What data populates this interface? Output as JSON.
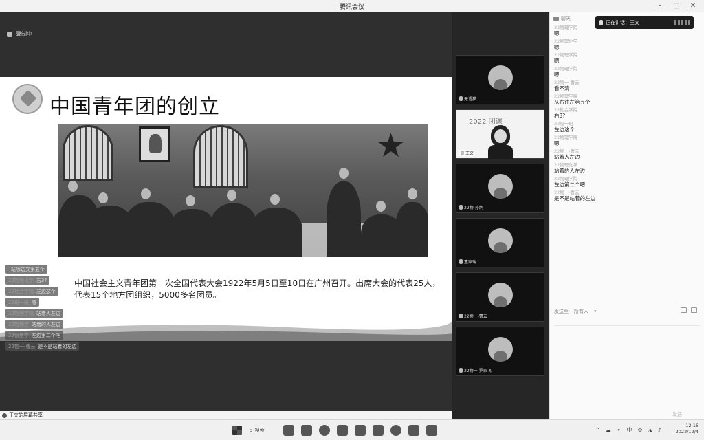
{
  "window": {
    "title": "腾讯会议"
  },
  "recording": {
    "label": "录制中"
  },
  "slide": {
    "title": "中国青年团的创立",
    "body": "中国社会主义青年团第一次全国代表大会1922年5月5日至10日在广州召开。出席大会的代表25人，代表15个地方团组织，5000多名团员。"
  },
  "overlay_chat": [
    {
      "sender": "",
      "text": "站哪边文第五个"
    },
    {
      "sender": "22物理化学",
      "text": "右3?"
    },
    {
      "sender": "22社会学院",
      "text": "左边这个"
    },
    {
      "sender": "22级一班",
      "text": "嗯"
    },
    {
      "sender": "22物理学院",
      "text": "站着人左边"
    },
    {
      "sender": "22物理学",
      "text": "站着的人左边"
    },
    {
      "sender": "22智慧学",
      "text": "左边第二个吧"
    },
    {
      "sender": "22物一-曹云",
      "text": "是不是站着的左边"
    }
  ],
  "share_note": "王文的屏幕共享",
  "speaking": {
    "label": "正在讲话：王文"
  },
  "participants": [
    {
      "name": "无语猫",
      "type": "avatar"
    },
    {
      "name": "王文",
      "type": "video",
      "bg_text": "2022 团课"
    },
    {
      "name": "22物-孙炳",
      "type": "avatar"
    },
    {
      "name": "董家瑞",
      "type": "avatar"
    },
    {
      "name": "22物一-曹云",
      "type": "avatar"
    },
    {
      "name": "22物一-罗家飞",
      "type": "avatar"
    }
  ],
  "chat_panel": {
    "header": "聊天",
    "messages": [
      {
        "sender": "22物理学院",
        "text": "嗯"
      },
      {
        "sender": "22物理化学",
        "text": "嗯"
      },
      {
        "sender": "22物理学院",
        "text": "嗯"
      },
      {
        "sender": "22物理学院",
        "text": "嗯"
      },
      {
        "sender": "22物一-曹云",
        "text": "看不清"
      },
      {
        "sender": "22物理学院",
        "text": "从右往左第五个"
      },
      {
        "sender": "22社会学院",
        "text": "右3?"
      },
      {
        "sender": "22级一班",
        "text": "左边这个"
      },
      {
        "sender": "22物理学院",
        "text": "嗯"
      },
      {
        "sender": "22物一-曹云",
        "text": "站着人左边"
      },
      {
        "sender": "22物理化学",
        "text": "站着的人左边"
      },
      {
        "sender": "22物理学院",
        "text": "左边第二个吧"
      },
      {
        "sender": "22物一-曹云",
        "text": "是不是站着的左边"
      }
    ],
    "send_label": "发送至",
    "send_target": "所有人",
    "send_button": "发送"
  },
  "taskbar": {
    "search_label": "搜索",
    "ime": "中",
    "time": "12:16",
    "date": "2022/12/4"
  }
}
